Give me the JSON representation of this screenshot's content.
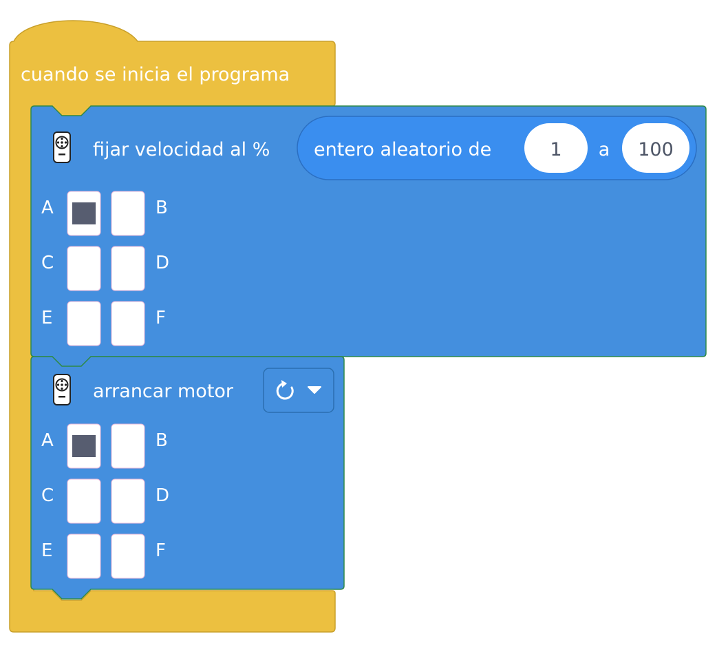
{
  "colors": {
    "event": "#ecc040",
    "event_border": "#c9a02a",
    "action": "#448fde",
    "action_border": "#2f8a4a",
    "reporter": "#3a8eef",
    "port_selected": "#575d70",
    "port_empty": "#ffffff"
  },
  "event_block": {
    "label": "cuando se inicia el programa"
  },
  "speed_block": {
    "icon": "motor-icon",
    "label": "fijar velocidad al %",
    "random": {
      "label": "entero aleatorio de",
      "from": "1",
      "separator": "a",
      "to": "100"
    },
    "ports": [
      {
        "left": "A",
        "right": "B",
        "left_selected": true,
        "right_selected": false
      },
      {
        "left": "C",
        "right": "D",
        "left_selected": false,
        "right_selected": false
      },
      {
        "left": "E",
        "right": "F",
        "left_selected": false,
        "right_selected": false
      }
    ]
  },
  "start_block": {
    "icon": "motor-icon",
    "label": "arrancar motor",
    "direction": {
      "icon": "rotate-clockwise-icon",
      "dropdown_icon": "caret-down-icon"
    },
    "ports": [
      {
        "left": "A",
        "right": "B",
        "left_selected": true,
        "right_selected": false
      },
      {
        "left": "C",
        "right": "D",
        "left_selected": false,
        "right_selected": false
      },
      {
        "left": "E",
        "right": "F",
        "left_selected": false,
        "right_selected": false
      }
    ]
  }
}
